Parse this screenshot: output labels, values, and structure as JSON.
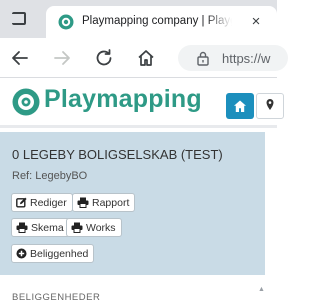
{
  "browser": {
    "tab_title": "Playmapping company | Playgro",
    "url": "https://w",
    "icons": [
      "tab-switcher-icon",
      "favicon-icon",
      "close-icon",
      "back-arrow-icon",
      "forward-arrow-icon",
      "reload-icon",
      "home-icon",
      "lock-icon"
    ],
    "close_glyph": "×"
  },
  "site": {
    "logo_text": "Playmapping",
    "brand_color": "#2e9a86",
    "accent_color": "#1c8fbd",
    "nav_icons": [
      "home-icon",
      "map-pin-icon"
    ]
  },
  "panel": {
    "title": "0 LEGEBY BOLIGSELSKAB (TEST)",
    "ref": "Ref: LegebyBO",
    "buttons": {
      "rediger": "Rediger",
      "rapport": "Rapport",
      "skema": "Skema",
      "works": "Works",
      "beliggenhed": "Beliggenhed"
    },
    "background": "#c9dbe6"
  },
  "section": {
    "label": "BELIGGENHEDER"
  }
}
